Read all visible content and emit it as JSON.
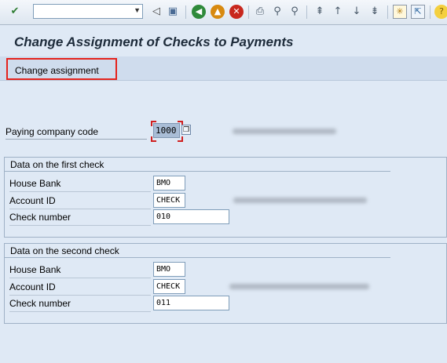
{
  "toolbar": {
    "icons": [
      "enter-icon",
      "back-icon",
      "exit-icon",
      "cancel-icon",
      "save-icon",
      "print-icon",
      "find-icon",
      "find-next-icon",
      "first-page-icon",
      "previous-page-icon",
      "next-page-icon",
      "last-page-icon",
      "new-session-icon",
      "shortcut-icon",
      "help-icon"
    ],
    "command_field_value": ""
  },
  "title": "Change Assignment of Checks to Payments",
  "app_toolbar": {
    "change_assignment_label": "Change assignment"
  },
  "paying_company": {
    "label": "Paying company code",
    "value": "1000"
  },
  "first_check": {
    "heading": "Data on the first check",
    "house_bank_label": "House Bank",
    "house_bank_value": "BMO",
    "account_id_label": "Account ID",
    "account_id_value": "CHECK",
    "check_number_label": "Check number",
    "check_number_value": "010"
  },
  "second_check": {
    "heading": "Data on the second check",
    "house_bank_label": "House Bank",
    "house_bank_value": "BMO",
    "account_id_label": "Account ID",
    "account_id_value": "CHECK",
    "check_number_label": "Check number",
    "check_number_value": "011"
  },
  "colors": {
    "background": "#dfe9f5",
    "highlight_border": "#e5231d",
    "title_text": "#1d2b3a"
  }
}
